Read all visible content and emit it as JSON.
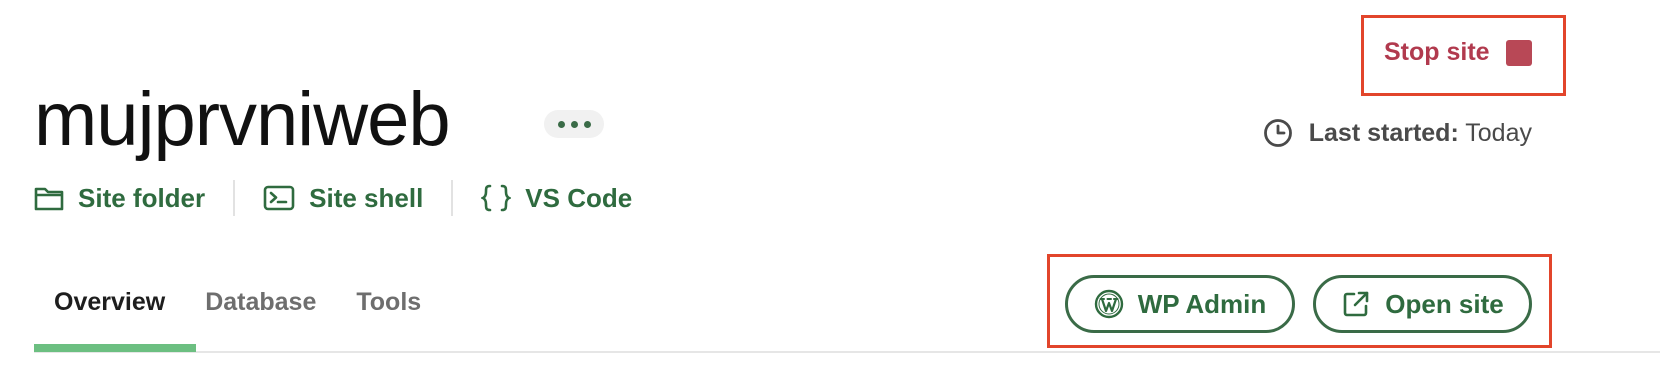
{
  "site": {
    "name": "mujprvniweb"
  },
  "links": {
    "folder": "Site folder",
    "shell": "Site shell",
    "vscode": "VS Code"
  },
  "status": {
    "stop_label": "Stop site",
    "last_started_label": "Last started:",
    "last_started_value": "Today"
  },
  "tabs": [
    {
      "label": "Overview",
      "active": true
    },
    {
      "label": "Database",
      "active": false
    },
    {
      "label": "Tools",
      "active": false
    }
  ],
  "actions": {
    "wp_admin": "WP Admin",
    "open_site": "Open site"
  },
  "icons": {
    "folder": "folder-icon",
    "shell": "terminal-icon",
    "vscode": "braces-icon",
    "clock": "clock-icon",
    "wordpress": "wordpress-icon",
    "external": "external-link-icon",
    "stop": "stop-square-icon",
    "more": "more-horizontal-icon"
  },
  "colors": {
    "accent_green": "#2f6b3f",
    "tab_indicator": "#6cbf81",
    "stop_red": "#b13a4e",
    "highlight_box": "#e2452b"
  }
}
